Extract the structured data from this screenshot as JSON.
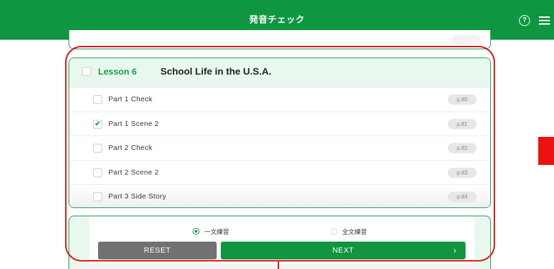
{
  "header": {
    "title": "発音チェック",
    "help_icon": "help-circle-icon",
    "help_glyph": "?",
    "menu_icon": "hamburger-menu-icon"
  },
  "lesson": {
    "number_label": "Lesson 6",
    "title": "School Life in the U.S.A.",
    "checked": false,
    "parts": [
      {
        "label": "Part 1 Check",
        "page": "p.80",
        "checked": false
      },
      {
        "label": "Part 1 Scene 2",
        "page": "p.81",
        "checked": true
      },
      {
        "label": "Part 2 Check",
        "page": "p.82",
        "checked": false
      },
      {
        "label": "Part 2 Scene 2",
        "page": "p.83",
        "checked": false
      },
      {
        "label": "Part 3 Side Story",
        "page": "p.84",
        "checked": false
      }
    ]
  },
  "practice_mode": {
    "options": [
      {
        "label": "一文練習",
        "selected": true
      },
      {
        "label": "全文練習",
        "selected": false
      }
    ]
  },
  "actions": {
    "reset_label": "RESET",
    "next_label": "NEXT",
    "next_chevron": "›"
  },
  "colors": {
    "brand_green": "#0f9641",
    "header_tint": "#e8f8ee",
    "reset_gray": "#717171",
    "highlight_red": "#e31212"
  }
}
